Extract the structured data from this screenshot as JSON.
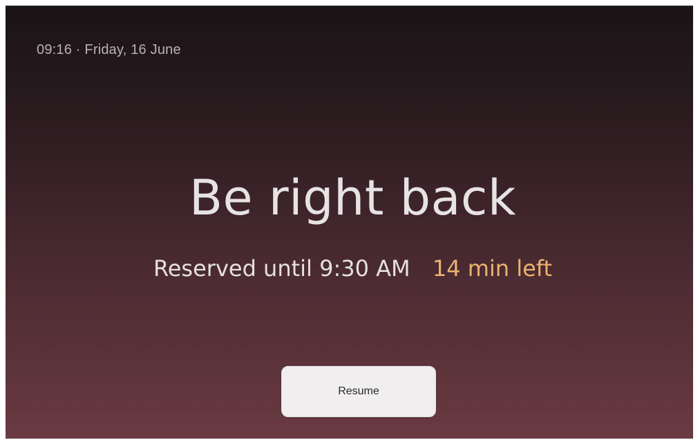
{
  "status_bar": {
    "time_date": "09:16 · Friday, 16 June"
  },
  "main": {
    "title": "Be right back",
    "reserved_text": "Reserved until 9:30 AM",
    "time_left": "14 min left"
  },
  "actions": {
    "resume_label": "Resume"
  },
  "colors": {
    "accent": "#e9b36f",
    "background_top": "#1a1416",
    "background_bottom": "#6a3a41",
    "button_bg": "#f0eeef"
  }
}
